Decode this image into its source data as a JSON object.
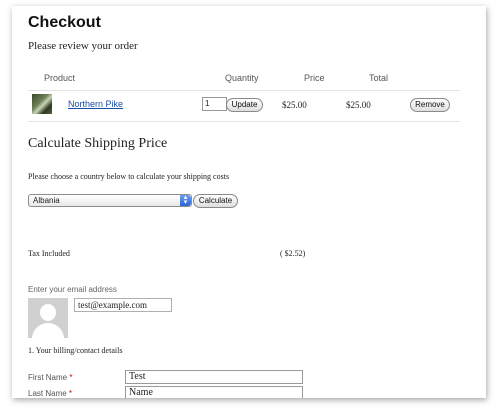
{
  "page": {
    "title": "Checkout",
    "review_text": "Please review your order"
  },
  "cart": {
    "headers": {
      "product": "Product",
      "quantity": "Quantity",
      "price": "Price",
      "total": "Total"
    },
    "items": [
      {
        "name": "Northern Pike",
        "quantity": "1",
        "price": "$25.00",
        "total": "$25.00"
      }
    ],
    "update_label": "Update",
    "remove_label": "Remove"
  },
  "shipping": {
    "title": "Calculate Shipping Price",
    "note": "Please choose a country below to calculate your shipping costs",
    "selected_country": "Albania",
    "calculate_label": "Calculate"
  },
  "tax": {
    "label": "Tax Included",
    "value": "( $2.52)"
  },
  "email": {
    "label": "Enter your email address",
    "value": "test@example.com"
  },
  "billing": {
    "heading": "1. Your billing/contact details",
    "fields": [
      {
        "label": "First Name",
        "value": "Test"
      },
      {
        "label": "Last Name",
        "value": "Name"
      }
    ],
    "required_mark": "*"
  },
  "icons": {
    "select_arrow": "select-arrows-icon",
    "avatar": "default-avatar-icon"
  },
  "colors": {
    "link": "#1a4fa8",
    "required": "#cc0000",
    "select_arrow": "#2a64d6"
  }
}
